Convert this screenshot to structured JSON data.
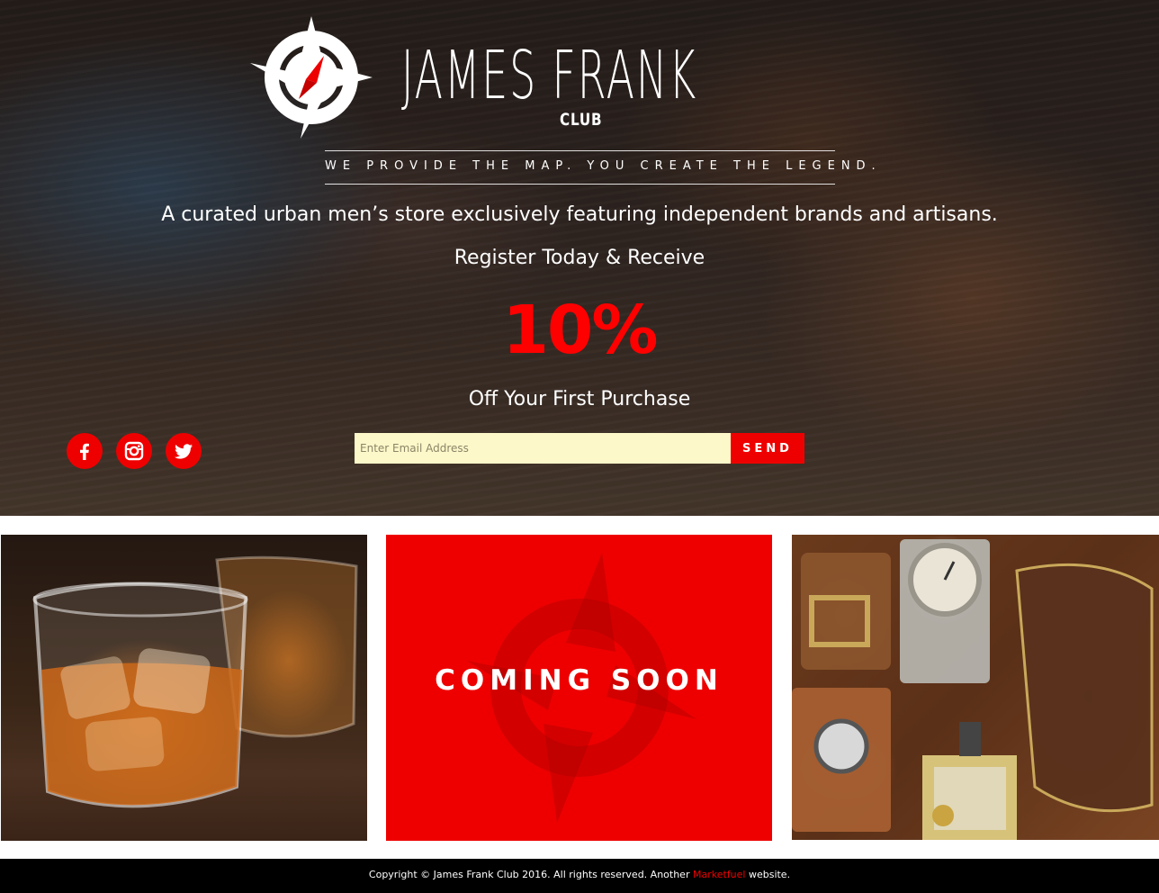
{
  "brand": {
    "name": "JAMES FRANK",
    "sub": "CLUB",
    "tagline": "WE PROVIDE THE MAP. YOU CREATE THE LEGEND."
  },
  "hero": {
    "curated": "A curated urban men’s store exclusively featuring independent brands and artisans.",
    "register": "Register Today & Receive",
    "discount": "10%",
    "off": "Off Your First Purchase"
  },
  "form": {
    "email_placeholder": "Enter Email Address",
    "send_label": "SEND"
  },
  "social": [
    {
      "icon": "facebook-icon"
    },
    {
      "icon": "instagram-icon"
    },
    {
      "icon": "twitter-icon"
    }
  ],
  "tiles": {
    "coming_soon": "COMING SOON"
  },
  "footer": {
    "copyright": "Copyright © James Frank Club 2016. All rights reserved. Another ",
    "link": "Marketfuel",
    "suffix": " website."
  },
  "colors": {
    "accent": "#ee0000",
    "input_bg": "#fdf8c9",
    "footer_bg": "#000000"
  }
}
